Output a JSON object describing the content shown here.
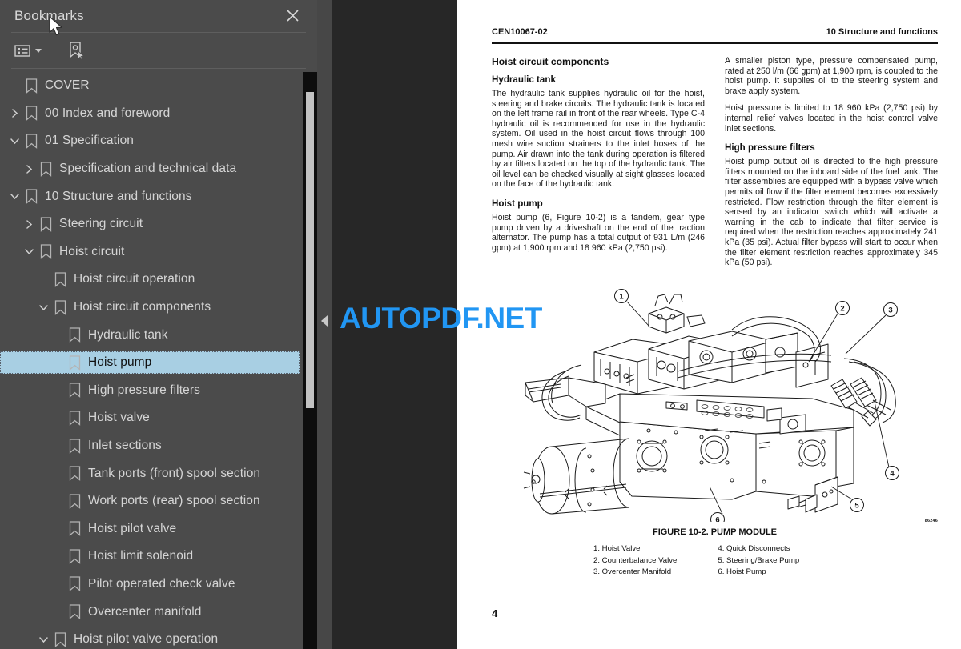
{
  "sidebar": {
    "title": "Bookmarks",
    "close_icon": "close-icon",
    "toolbar": {
      "options_icon": "list-options-icon",
      "new_bookmark_icon": "new-bookmark-icon"
    },
    "items": [
      {
        "label": "COVER",
        "depth": 0,
        "chevron": "none"
      },
      {
        "label": "00 Index and foreword",
        "depth": 0,
        "chevron": "collapsed"
      },
      {
        "label": "01 Specification",
        "depth": 0,
        "chevron": "expanded"
      },
      {
        "label": "Specification and technical data",
        "depth": 1,
        "chevron": "collapsed"
      },
      {
        "label": "10 Structure and functions",
        "depth": 0,
        "chevron": "expanded"
      },
      {
        "label": "Steering circuit",
        "depth": 1,
        "chevron": "collapsed"
      },
      {
        "label": "Hoist circuit",
        "depth": 1,
        "chevron": "expanded"
      },
      {
        "label": "Hoist circuit operation",
        "depth": 2,
        "chevron": "none"
      },
      {
        "label": "Hoist circuit components",
        "depth": 2,
        "chevron": "expanded"
      },
      {
        "label": "Hydraulic tank",
        "depth": 3,
        "chevron": "none"
      },
      {
        "label": "Hoist pump",
        "depth": 3,
        "chevron": "none",
        "selected": true
      },
      {
        "label": "High pressure filters",
        "depth": 3,
        "chevron": "none"
      },
      {
        "label": "Hoist valve",
        "depth": 3,
        "chevron": "none"
      },
      {
        "label": "Inlet sections",
        "depth": 3,
        "chevron": "none"
      },
      {
        "label": "Tank ports (front) spool section",
        "depth": 3,
        "chevron": "none"
      },
      {
        "label": "Work ports (rear) spool section",
        "depth": 3,
        "chevron": "none"
      },
      {
        "label": "Hoist pilot valve",
        "depth": 3,
        "chevron": "none"
      },
      {
        "label": "Hoist limit solenoid",
        "depth": 3,
        "chevron": "none"
      },
      {
        "label": "Pilot operated check valve",
        "depth": 3,
        "chevron": "none"
      },
      {
        "label": "Overcenter manifold",
        "depth": 3,
        "chevron": "none"
      },
      {
        "label": "Hoist pilot valve operation",
        "depth": 2,
        "chevron": "expanded"
      }
    ]
  },
  "viewer": {
    "collapse_arrow_icon": "collapse-left-icon",
    "watermark": "AUTOPDF.NET"
  },
  "page": {
    "header_left": "CEN10067-02",
    "header_right": "10 Structure and functions",
    "page_number": "4",
    "left_column": {
      "title": "Hoist circuit components",
      "sections": [
        {
          "heading": "Hydraulic tank",
          "body": "The hydraulic tank supplies hydraulic oil for the hoist, steering and brake circuits. The hydraulic tank is located on the left frame rail in front of the rear wheels. Type C-4 hydraulic oil is recommended for use in the hydraulic system. Oil used in the hoist circuit flows through 100 mesh wire suction strainers to the inlet hoses of the pump. Air drawn into the tank during operation is filtered by air filters located on the top of the hydraulic tank. The oil level can be checked visually at sight glasses located on the face of the hydraulic tank."
        },
        {
          "heading": "Hoist pump",
          "body": "Hoist pump (6, Figure 10-2) is a tandem, gear type pump driven by a driveshaft on the end of the traction alternator. The pump has a total output of 931 L/m (246 gpm) at 1,900 rpm and 18 960 kPa (2,750 psi)."
        }
      ]
    },
    "right_column": {
      "intro_paragraphs": [
        "A smaller piston type, pressure compensated pump, rated at 250 l/m (66 gpm) at 1,900 rpm, is coupled to the hoist pump. It supplies oil to the steering system and brake apply system.",
        "Hoist pressure is limited to 18 960 kPa (2,750 psi) by internal relief valves located in the hoist control valve inlet sections."
      ],
      "sections": [
        {
          "heading": "High pressure filters",
          "body": "Hoist pump output oil is directed to the high pressure filters mounted on the inboard side of the fuel tank. The filter assemblies are equipped with a bypass valve which permits oil flow if the filter element becomes excessively restricted. Flow restriction through the filter element is sensed by an indicator switch which will activate a warning in the cab to indicate that filter service is required when the restriction reaches approximately 241 kPa (35 psi). Actual filter bypass will start to occur when the filter element restriction reaches approximately 345 kPa (50 psi)."
        }
      ]
    },
    "figure": {
      "caption": "FIGURE 10-2. PUMP MODULE",
      "drawing_code": "86246",
      "callouts": [
        "1",
        "2",
        "3",
        "4",
        "5",
        "6"
      ],
      "legend_left": [
        "1. Hoist Valve",
        "2. Counterbalance Valve",
        "3. Overcenter Manifold"
      ],
      "legend_right": [
        "4. Quick Disconnects",
        "5. Steering/Brake Pump",
        "6. Hoist Pump"
      ]
    }
  },
  "colors": {
    "sidebar_bg": "#4b4b4b",
    "viewer_bg": "#272727",
    "selection": "#a8cfe3",
    "watermark": "#2196f3"
  }
}
